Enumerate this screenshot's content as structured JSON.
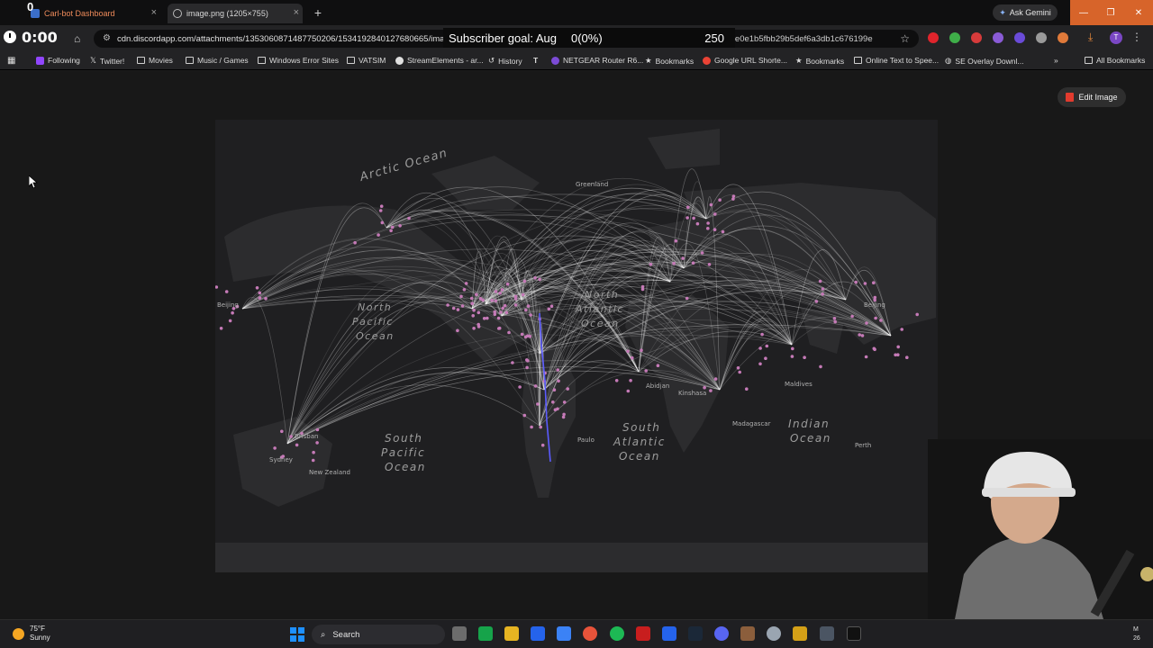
{
  "tabs": [
    {
      "label": "Carl-bot Dashboard",
      "color": "#ee8b5a"
    },
    {
      "label": "image.png (1205×755)",
      "color": "#d7d7d7"
    }
  ],
  "overlay": {
    "top_counter": "0",
    "timer": "0:00",
    "sub_goal_label": "Subscriber goal: Aug",
    "sub_goal_progress": "0(0%)",
    "sub_goal_target": "250"
  },
  "toolbar": {
    "url": "cdn.discordapp.com/attachments/1353060871487750206/1534192840127680665/image",
    "url_tail": "bfe0e1b5fbb29b5def6a3db1c676199e",
    "ask_gemini": "Ask Gemini",
    "avatar_letter": "T"
  },
  "bookmarks": [
    {
      "label": "Following",
      "icon": "twitch-icon"
    },
    {
      "label": "Twitter!",
      "icon": "x-icon"
    },
    {
      "label": "Movies",
      "icon": "folder-icon"
    },
    {
      "label": "Music / Games",
      "icon": "folder-icon"
    },
    {
      "label": "Windows Error Sites",
      "icon": "folder-icon"
    },
    {
      "label": "VATSIM",
      "icon": "folder-icon"
    },
    {
      "label": "StreamElements - ar...",
      "icon": "streamelements-icon"
    },
    {
      "label": "History",
      "icon": "history-icon"
    },
    {
      "label": "",
      "icon": "logo-icon"
    },
    {
      "label": "NETGEAR Router R6...",
      "icon": "netgear-icon"
    },
    {
      "label": "Bookmarks",
      "icon": "star-icon"
    },
    {
      "label": "Google URL Shorte...",
      "icon": "google-icon"
    },
    {
      "label": "Bookmarks",
      "icon": "star-icon"
    },
    {
      "label": "Online Text to Spee...",
      "icon": "page-icon"
    },
    {
      "label": "SE Overlay Downl...",
      "icon": "globe-icon"
    },
    {
      "label": "All Bookmarks",
      "icon": "folder-icon"
    }
  ],
  "page": {
    "edit_image": "Edit Image"
  },
  "map_labels": {
    "arctic": "Arctic Ocean",
    "north_pacific_1": "North",
    "north_pacific_2": "Pacific",
    "north_pacific_3": "Ocean",
    "north_atlantic_1": "North",
    "north_atlantic_2": "Atlantic",
    "north_atlantic_3": "Ocean",
    "south_atlantic_1": "South",
    "south_atlantic_2": "Atlantic",
    "south_atlantic_3": "Ocean",
    "south_pacific_1": "South",
    "south_pacific_2": "Pacific",
    "south_pacific_3": "Ocean",
    "indian_1": "Indian",
    "indian_2": "Ocean",
    "abidjan": "Abidjan",
    "kinshasa": "Kinshasa",
    "paulo": "Paulo",
    "brisban": "Brisban",
    "sydney": "Sydney",
    "perth": "Perth",
    "beijing_w": "Beijing",
    "beijing_e": "Beijing",
    "maldives": "Maldives",
    "madagascar": "Madagascar",
    "greenland": "Greenland",
    "new_zealand": "New Zealand"
  },
  "taskbar": {
    "temperature": "75°F",
    "condition": "Sunny",
    "search": "Search",
    "tray_top": "M",
    "tray_bottom": "26"
  },
  "colors": {
    "accent_orange": "#d7642a",
    "route_white": "#ffffff",
    "airport_pink": "#c57ab7",
    "route_blue": "#5b5bff"
  }
}
